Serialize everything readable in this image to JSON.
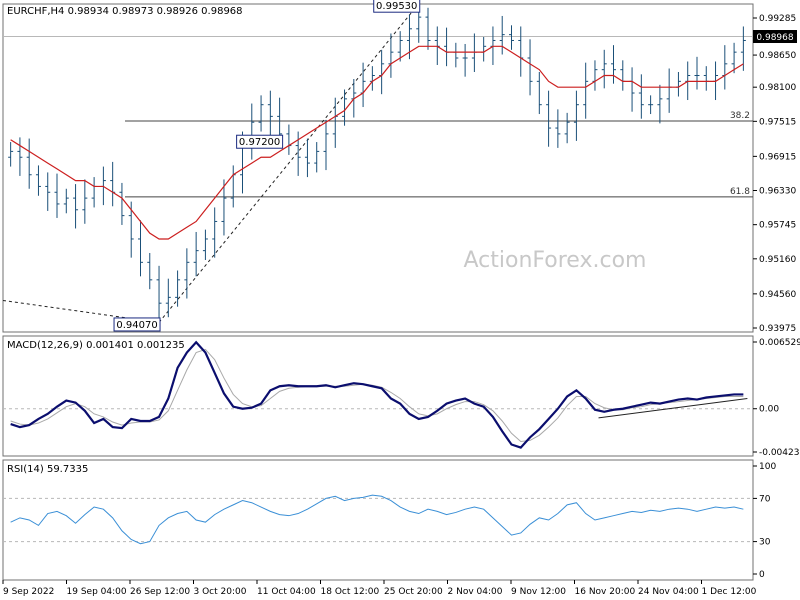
{
  "header": {
    "main_title": "EURCHF,H4  0.98934 0.98973 0.98926 0.98968",
    "macd_title": "MACD(12,26,9) 0.001401 0.001235",
    "rsi_title": "RSI(14) 59.7335"
  },
  "watermark": "ActionForex.com",
  "colors": {
    "bars": "#1a4f78",
    "ma": "#cc1f1f",
    "macd_line": "#0b0e6e",
    "signal_line": "#a9a9a9",
    "rsi_line": "#3a8fd6",
    "label_border": "#1a2a80",
    "grid": "#b8b8b8"
  },
  "chart_data": [
    {
      "type": "candlestick",
      "panel": "price",
      "ylim": [
        0.93975,
        0.99285
      ],
      "y_ticks": [
        "0.99285",
        "0.98650",
        "0.98100",
        "0.97515",
        "0.96915",
        "0.96330",
        "0.95745",
        "0.95160",
        "0.94560",
        "0.93975"
      ],
      "current_price": "0.98968",
      "annotations": [
        {
          "label": "0.99530",
          "value": 0.9953
        },
        {
          "label": "0.97200",
          "value": 0.972
        },
        {
          "label": "0.94070",
          "value": 0.9407
        }
      ],
      "fib_levels": [
        {
          "label": "38.2",
          "value": 0.9752
        },
        {
          "label": "61.8",
          "value": 0.9622
        }
      ],
      "series": [
        {
          "type": "ohlc",
          "close": [
            0.97,
            0.969,
            0.966,
            0.964,
            0.963,
            0.961,
            0.962,
            0.96,
            0.962,
            0.964,
            0.965,
            0.963,
            0.959,
            0.955,
            0.951,
            0.948,
            0.944,
            0.945,
            0.948,
            0.951,
            0.953,
            0.955,
            0.958,
            0.962,
            0.966,
            0.971,
            0.975,
            0.978,
            0.976,
            0.973,
            0.971,
            0.969,
            0.968,
            0.97,
            0.973,
            0.976,
            0.979,
            0.98,
            0.982,
            0.983,
            0.985,
            0.987,
            0.989,
            0.991,
            0.993,
            0.989,
            0.988,
            0.987,
            0.986,
            0.986,
            0.987,
            0.988,
            0.989,
            0.99,
            0.989,
            0.986,
            0.982,
            0.978,
            0.974,
            0.973,
            0.975,
            0.978,
            0.982,
            0.984,
            0.985,
            0.984,
            0.982,
            0.98,
            0.978,
            0.978,
            0.979,
            0.981,
            0.982,
            0.983,
            0.983,
            0.982,
            0.983,
            0.985,
            0.987,
            0.989
          ]
        },
        {
          "name": "",
          "type": "line",
          "values": [
            0.972,
            0.971,
            0.97,
            0.969,
            0.968,
            0.967,
            0.966,
            0.965,
            0.965,
            0.964,
            0.964,
            0.963,
            0.962,
            0.96,
            0.958,
            0.956,
            0.955,
            0.955,
            0.956,
            0.957,
            0.958,
            0.96,
            0.962,
            0.964,
            0.966,
            0.967,
            0.968,
            0.969,
            0.969,
            0.97,
            0.971,
            0.972,
            0.973,
            0.974,
            0.975,
            0.976,
            0.977,
            0.979,
            0.98,
            0.982,
            0.983,
            0.985,
            0.986,
            0.987,
            0.988,
            0.988,
            0.988,
            0.987,
            0.987,
            0.987,
            0.987,
            0.987,
            0.988,
            0.988,
            0.987,
            0.986,
            0.985,
            0.984,
            0.982,
            0.981,
            0.981,
            0.981,
            0.981,
            0.982,
            0.983,
            0.983,
            0.982,
            0.982,
            0.981,
            0.981,
            0.981,
            0.981,
            0.981,
            0.982,
            0.982,
            0.982,
            0.982,
            0.983,
            0.984,
            0.985
          ]
        }
      ]
    },
    {
      "type": "line",
      "panel": "macd",
      "ylim": [
        -0.004233,
        0.006529
      ],
      "y_ticks": [
        "0.006529",
        "0.00",
        "-0.004233"
      ],
      "zero_label": "0.00",
      "series": [
        {
          "name": "",
          "values": [
            -0.0015,
            -0.0018,
            -0.0016,
            -0.001,
            -0.0005,
            0.0002,
            0.0008,
            0.0006,
            -0.0002,
            -0.0014,
            -0.001,
            -0.0018,
            -0.0019,
            -0.001,
            -0.0012,
            -0.0012,
            -0.0008,
            0.001,
            0.004,
            0.0055,
            0.0065,
            0.0055,
            0.0035,
            0.0015,
            0.0002,
            0.0,
            0.0001,
            0.0005,
            0.0018,
            0.0022,
            0.0023,
            0.0022,
            0.0022,
            0.0022,
            0.0023,
            0.0021,
            0.0023,
            0.0025,
            0.0024,
            0.0022,
            0.002,
            0.001,
            0.0005,
            -0.0005,
            -0.001,
            -0.0008,
            -0.0002,
            0.0005,
            0.0008,
            0.001,
            0.0005,
            0.0002,
            -0.0008,
            -0.0022,
            -0.0035,
            -0.0038,
            -0.0028,
            -0.002,
            -0.001,
            0.0,
            0.0012,
            0.0018,
            0.001,
            -0.0001,
            -0.0003,
            -0.0001,
            0.0,
            0.0002,
            0.0004,
            0.0006,
            0.0005,
            0.0007,
            0.0009,
            0.001,
            0.0009,
            0.0011,
            0.0012,
            0.0013,
            0.0014,
            0.0014
          ]
        },
        {
          "name": "",
          "values": [
            -0.0012,
            -0.0015,
            -0.0016,
            -0.0014,
            -0.001,
            -0.0004,
            0.0002,
            0.0005,
            0.0002,
            -0.0005,
            -0.0008,
            -0.0013,
            -0.0016,
            -0.0014,
            -0.0013,
            -0.0013,
            -0.0011,
            -0.0002,
            0.0018,
            0.0038,
            0.0055,
            0.0058,
            0.0048,
            0.003,
            0.0014,
            0.0005,
            0.0002,
            0.0003,
            0.001,
            0.0017,
            0.002,
            0.0021,
            0.0022,
            0.0022,
            0.0022,
            0.0022,
            0.0022,
            0.0023,
            0.0024,
            0.0023,
            0.0021,
            0.0016,
            0.001,
            0.0002,
            -0.0005,
            -0.0007,
            -0.0005,
            0.0,
            0.0004,
            0.0007,
            0.0007,
            0.0004,
            -0.0002,
            -0.0012,
            -0.0024,
            -0.0032,
            -0.0031,
            -0.0026,
            -0.0018,
            -0.0009,
            0.0003,
            0.0012,
            0.0012,
            0.0005,
            0.0001,
            -0.0001,
            -0.0001,
            0.0001,
            0.0002,
            0.0004,
            0.0005,
            0.0006,
            0.0007,
            0.0008,
            0.0009,
            0.001,
            0.0011,
            0.0012,
            0.0012,
            0.0012
          ]
        }
      ]
    },
    {
      "type": "line",
      "panel": "rsi",
      "ylim": [
        0,
        100
      ],
      "y_ticks": [
        "100",
        "70",
        "30",
        "0"
      ],
      "levels": [
        70,
        30
      ],
      "series": [
        {
          "name": "",
          "values": [
            48,
            52,
            50,
            45,
            56,
            58,
            54,
            47,
            55,
            62,
            60,
            52,
            40,
            32,
            28,
            30,
            45,
            52,
            56,
            58,
            50,
            48,
            55,
            60,
            64,
            68,
            66,
            62,
            58,
            55,
            54,
            56,
            60,
            65,
            70,
            72,
            68,
            70,
            71,
            73,
            72,
            68,
            62,
            58,
            56,
            60,
            58,
            55,
            57,
            60,
            62,
            60,
            52,
            44,
            36,
            38,
            46,
            52,
            50,
            56,
            64,
            66,
            56,
            50,
            52,
            54,
            56,
            58,
            57,
            59,
            58,
            60,
            61,
            60,
            58,
            60,
            62,
            61,
            62,
            60
          ]
        }
      ]
    }
  ],
  "x_axis": {
    "labels": [
      "9 Sep 2022",
      "19 Sep 04:00",
      "26 Sep 12:00",
      "3 Oct 20:00",
      "11 Oct 04:00",
      "18 Oct 12:00",
      "25 Oct 20:00",
      "2 Nov 04:00",
      "9 Nov 12:00",
      "16 Nov 20:00",
      "24 Nov 04:00",
      "1 Dec 12:00"
    ]
  }
}
